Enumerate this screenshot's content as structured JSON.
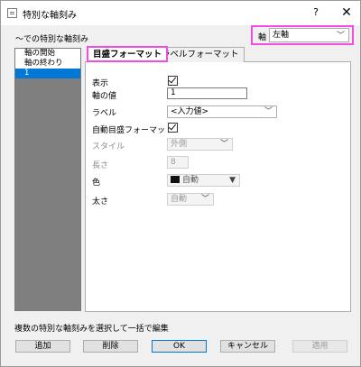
{
  "window": {
    "title": "特別な軸刻み",
    "help": "?",
    "close": "✕"
  },
  "header": {
    "label": "～での特別な軸刻み",
    "axis_label": "軸",
    "axis_value": "左軸"
  },
  "list": {
    "items": [
      "軸の開始",
      "軸の終わり",
      "1"
    ],
    "selected_index": 2
  },
  "tabs": {
    "active": "目盛フォーマット",
    "inactive": "ラベルフォーマット"
  },
  "form": {
    "show_label": "表示",
    "show_checked": true,
    "axis_value_label": "軸の値",
    "axis_value": "1",
    "label_label": "ラベル",
    "label_value": "<入力値>",
    "auto_tick_label": "自動目盛フォーマット",
    "auto_tick_checked": true,
    "style_label": "スタイル",
    "style_value": "外側",
    "length_label": "長さ",
    "length_value": "8",
    "color_label": "色",
    "color_value": "自動",
    "thickness_label": "太さ",
    "thickness_value": "自動"
  },
  "footer": {
    "note": "複数の特別な軸刻みを選択して一括で編集",
    "add": "追加",
    "delete": "削除",
    "ok": "OK",
    "cancel": "キャンセル",
    "apply": "適用"
  },
  "colors": {
    "highlight": "#f34ce2",
    "selection": "#0078d7",
    "color_swatch": "#111111"
  },
  "icons": {
    "window": "window-icon",
    "dropdown": "chevron-down-icon",
    "check": "check-icon"
  }
}
